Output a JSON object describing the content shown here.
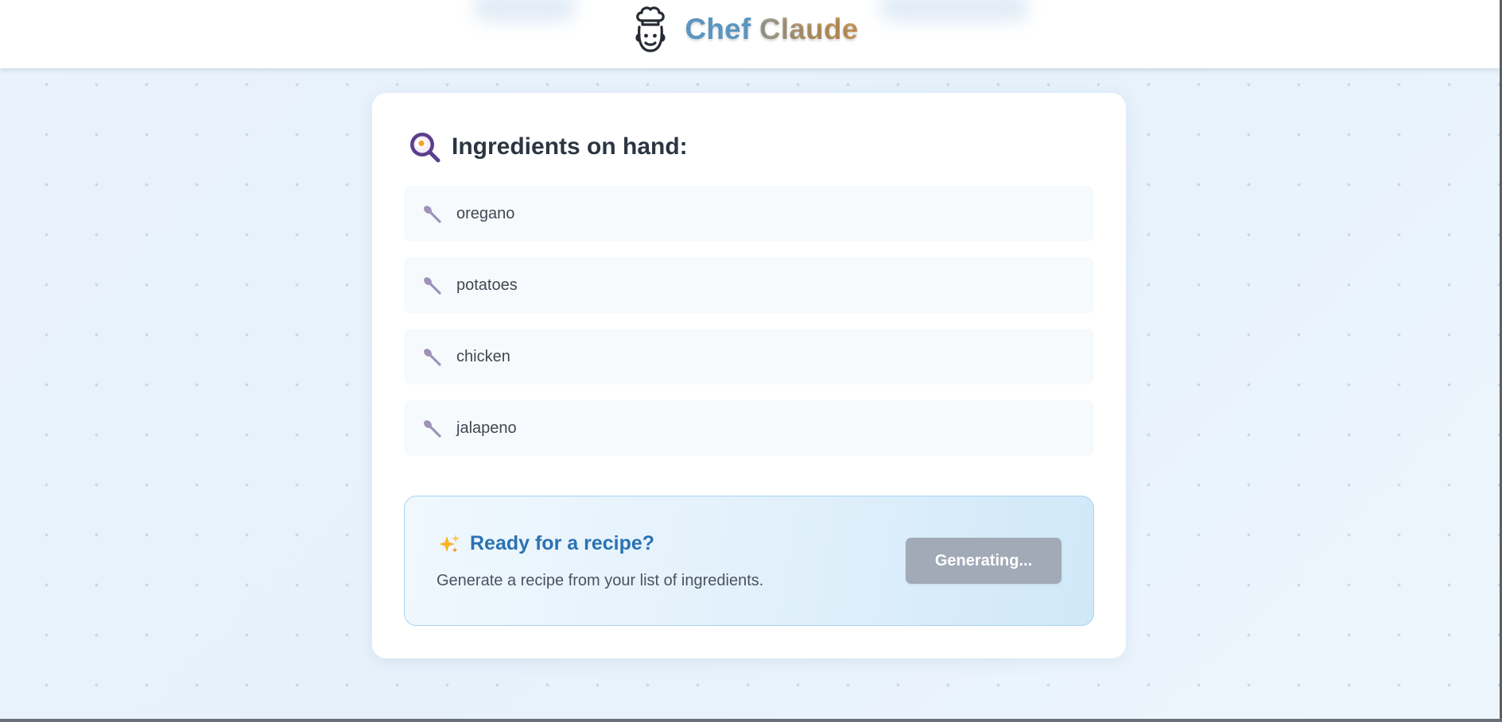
{
  "header": {
    "brand_first": "Chef",
    "brand_second": "Claude",
    "logo_icon": "chef-hat-face-icon"
  },
  "ingredients": {
    "title": "Ingredients on hand:",
    "title_icon": "frying-pan-egg-icon",
    "item_icon": "spoon-icon",
    "items": [
      {
        "name": "oregano"
      },
      {
        "name": "potatoes"
      },
      {
        "name": "chicken"
      },
      {
        "name": "jalapeno"
      }
    ]
  },
  "cta": {
    "icon": "sparkles-icon",
    "title": "Ready for a recipe?",
    "subtitle": "Generate a recipe from your list of ingredients.",
    "button_label": "Generating..."
  },
  "colors": {
    "brand_blue": "#5b95c0",
    "brand_gold": "#c49e67",
    "cta_title": "#2a72b4",
    "button_disabled": "#a2aab8",
    "icon_purple": "#5b3f8c"
  }
}
